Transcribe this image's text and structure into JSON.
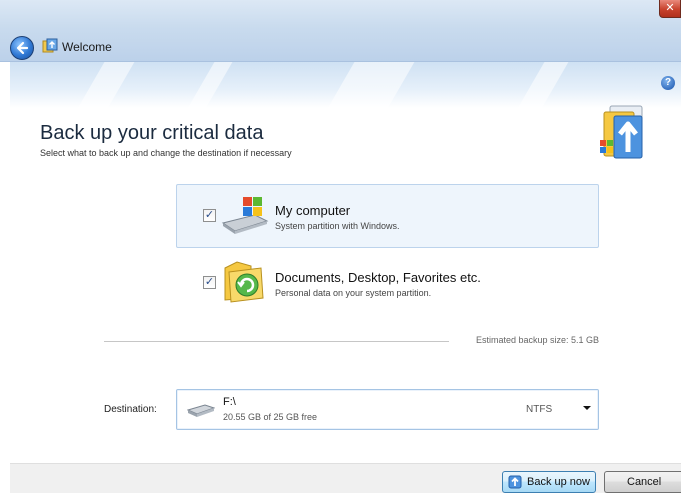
{
  "window": {
    "title": "Welcome",
    "close_label": "✕",
    "help_label": "?"
  },
  "header": {
    "title": "Back up your critical data",
    "subtitle": "Select what to back up and change the destination if necessary"
  },
  "options": [
    {
      "title": "My computer",
      "description": "System partition with Windows.",
      "checked": true,
      "check_glyph": "✓"
    },
    {
      "title": "Documents, Desktop, Favorites etc.",
      "description": "Personal data on your system partition.",
      "checked": true,
      "check_glyph": "✓"
    }
  ],
  "estimate": {
    "text": "Estimated backup size:  5.1 GB"
  },
  "destination": {
    "label": "Destination:",
    "drive": "F:\\",
    "free": "20.55 GB of 25 GB free",
    "filesystem": "NTFS"
  },
  "buttons": {
    "backup": "Back up now",
    "cancel": "Cancel"
  },
  "colors": {
    "accent": "#3c7fb1",
    "selected_bg": "#eef5fc",
    "selected_border": "#bcd3ec"
  },
  "icons": {
    "back": "back-arrow-icon",
    "app": "backup-app-icon",
    "help": "help-icon",
    "hero": "backup-hero-icon",
    "computer": "computer-drive-icon",
    "documents": "documents-folder-icon",
    "drive": "hard-drive-icon",
    "shield": "uac-shield-icon"
  }
}
